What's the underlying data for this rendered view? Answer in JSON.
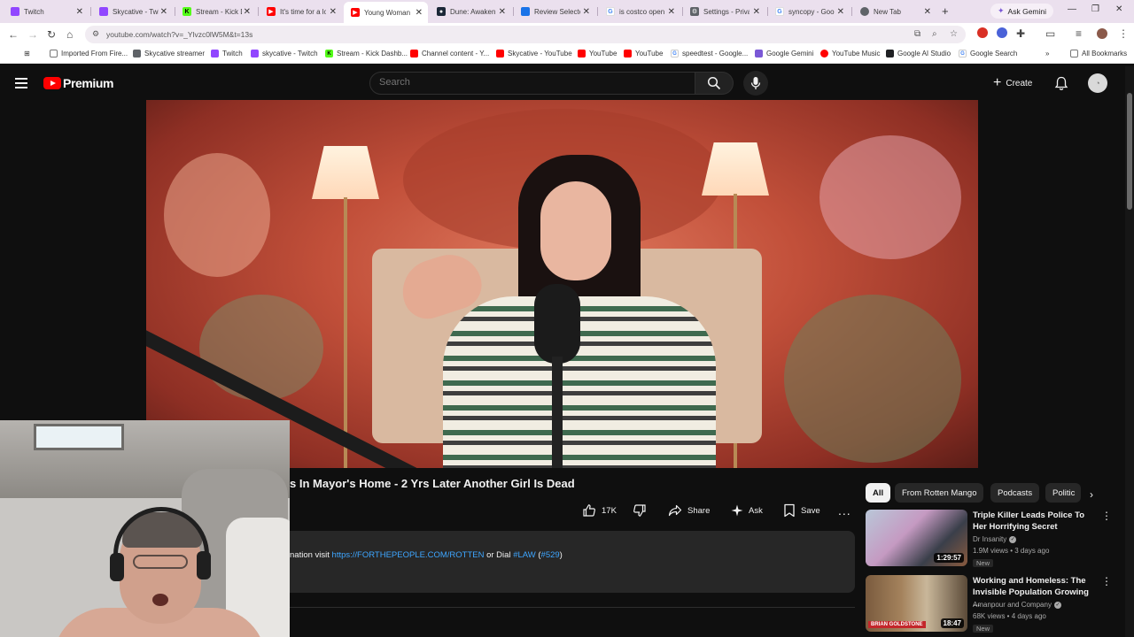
{
  "browser": {
    "tabs": [
      {
        "label": "Twitch",
        "icon": "twitch-icon",
        "color": "#9146ff",
        "active": false
      },
      {
        "label": "Skycative - Twitch",
        "icon": "twitch-icon",
        "color": "#9146ff",
        "active": false
      },
      {
        "label": "Stream - Kick Dashboard",
        "icon": "kick-icon",
        "color": "#53fc18",
        "active": false
      },
      {
        "label": "It's time for a loyalty",
        "icon": "youtube-icon",
        "color": "#ff0000",
        "active": false
      },
      {
        "label": "Young Woman",
        "icon": "youtube-icon",
        "color": "#ff0000",
        "active": true
      },
      {
        "label": "Dune: Awakening",
        "icon": "steam-icon",
        "color": "#1b2838",
        "active": false
      },
      {
        "label": "Review Selected",
        "icon": "page-icon",
        "color": "#1a73e8",
        "active": false
      },
      {
        "label": "is costco open",
        "icon": "google-icon",
        "color": "#4285f4",
        "active": false
      },
      {
        "label": "Settings - Privacy",
        "icon": "gear-icon",
        "color": "#5f6368",
        "active": false
      },
      {
        "label": "syncopy - Google",
        "icon": "google-icon",
        "color": "#4285f4",
        "active": false
      },
      {
        "label": "New Tab",
        "icon": "chrome-icon",
        "color": "#5f6368",
        "active": false
      }
    ],
    "new_tab_symbol": "+",
    "ask_gemini": "Ask Gemini",
    "url": "youtube.com/watch?v=_Ylvzc0lW5M&t=13s",
    "bookmarks": [
      {
        "label": "Imported From Fire...",
        "icon": "folder-icon",
        "color": "#5f6368"
      },
      {
        "label": "Skycative streamer",
        "icon": "globe-icon",
        "color": "#5f6368"
      },
      {
        "label": "Twitch",
        "icon": "twitch-icon",
        "color": "#9146ff"
      },
      {
        "label": "skycative - Twitch",
        "icon": "twitch-icon",
        "color": "#9146ff"
      },
      {
        "label": "Stream - Kick Dashb...",
        "icon": "kick-icon",
        "color": "#53fc18"
      },
      {
        "label": "Channel content - Y...",
        "icon": "youtube-studio-icon",
        "color": "#ff0000"
      },
      {
        "label": "Skycative - YouTube",
        "icon": "youtube-icon",
        "color": "#ff0000"
      },
      {
        "label": "YouTube",
        "icon": "youtube-icon",
        "color": "#ff0000"
      },
      {
        "label": "YouTube",
        "icon": "youtube-icon",
        "color": "#ff0000"
      },
      {
        "label": "speedtest - Google...",
        "icon": "google-icon",
        "color": "#4285f4"
      },
      {
        "label": "Google Gemini",
        "icon": "gemini-icon",
        "color": "#7a58d6"
      },
      {
        "label": "YouTube Music",
        "icon": "youtube-music-icon",
        "color": "#ff0000"
      },
      {
        "label": "Google AI Studio",
        "icon": "ai-studio-icon",
        "color": "#202124"
      },
      {
        "label": "Google Search",
        "icon": "google-icon",
        "color": "#4285f4"
      }
    ],
    "all_bookmarks": "All Bookmarks"
  },
  "youtube": {
    "brand": "Premium",
    "search_placeholder": "Search",
    "create_label": "Create",
    "video_title": "s In Mayor's Home - 2 Yrs Later Another Girl Is Dead",
    "actions": {
      "likes": "17K",
      "share": "Share",
      "ask": "Ask",
      "save": "Save",
      "more": "..."
    },
    "description": {
      "prefix": "nation visit ",
      "link": "https://FORTHEPEOPLE.COM/ROTTEN",
      "middle": " or Dial ",
      "hashtag": "#LAW",
      "paren_open": " (",
      "number_link": "#529",
      "paren_close": ")"
    },
    "chips": [
      "All",
      "From Rotten Mango",
      "Podcasts",
      "Politic"
    ],
    "recommendations": [
      {
        "title": "Triple Killer Leads Police To Her Horrifying Secret",
        "channel": "Dr Insanity",
        "meta": "1.9M views • 3 days ago",
        "badge": "New",
        "duration": "1:29:57"
      },
      {
        "title": "Working and Homeless: The Invisible Population Growing ...",
        "channel": "Amanpour and Company",
        "meta": "68K views • 4 days ago",
        "badge": "New",
        "duration": "18:47",
        "thumb_caption": "BRIAN GOLDSTONE"
      }
    ]
  },
  "colors": {
    "yt_bg": "#0f0f0f",
    "yt_red": "#ff0000",
    "link_blue": "#3ea6ff",
    "tab_strip": "#ebe0ee"
  }
}
